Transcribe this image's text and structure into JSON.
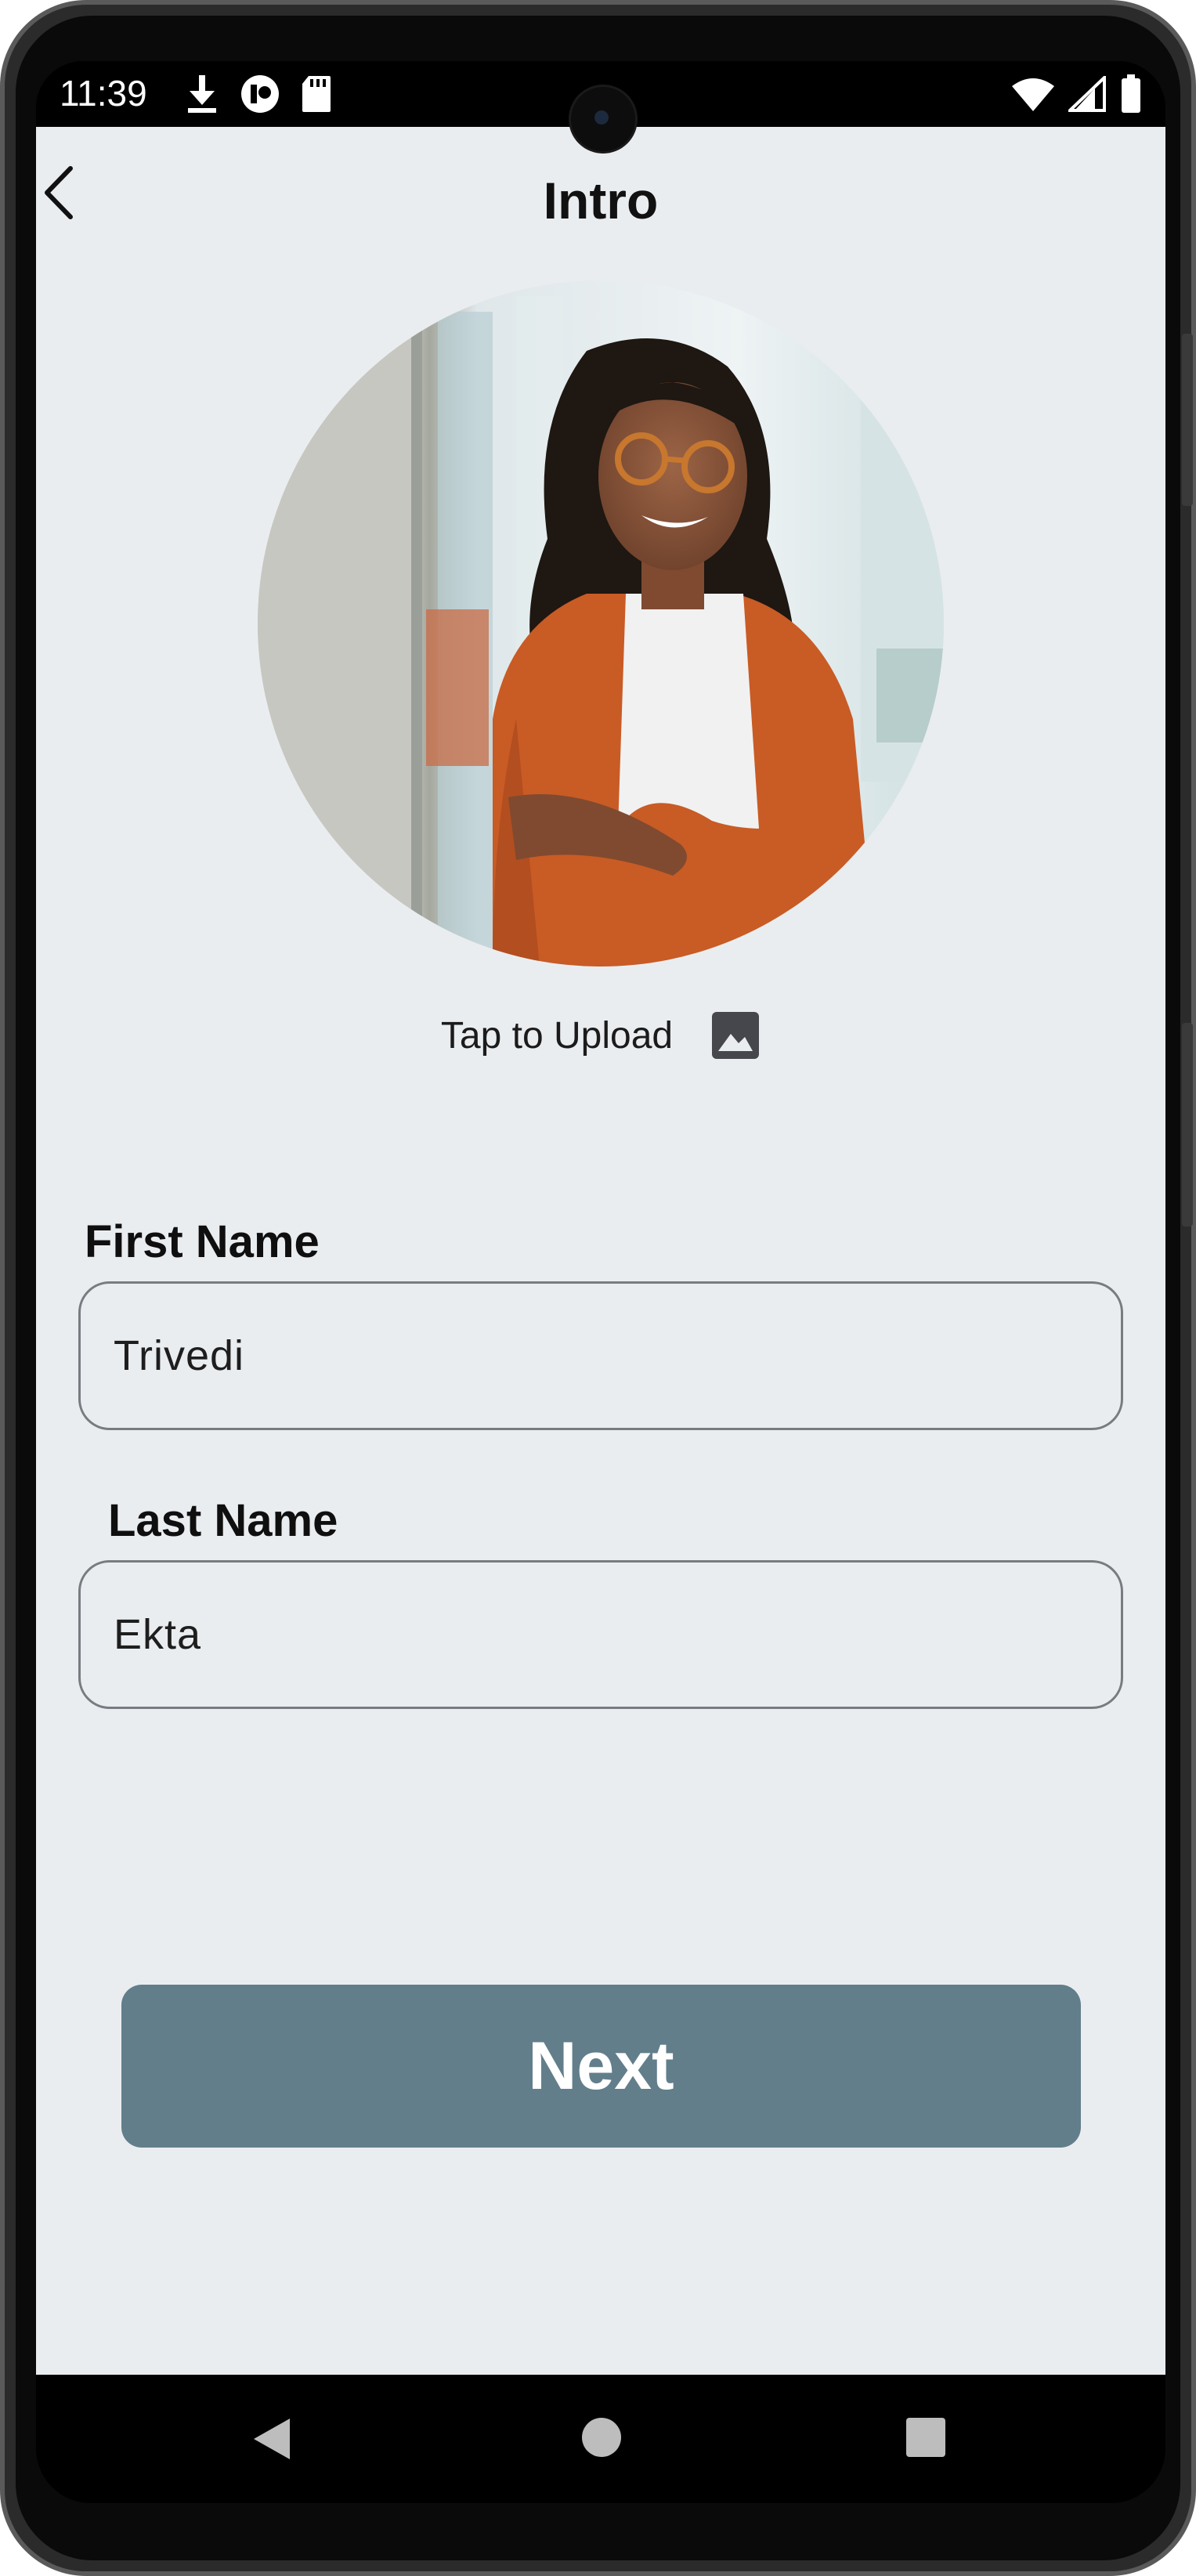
{
  "status_bar": {
    "time": "11:39",
    "left_icons": [
      "download-icon",
      "vpn-icon",
      "sd-card-icon"
    ],
    "right_icons": [
      "wifi-icon",
      "signal-icon",
      "battery-icon"
    ]
  },
  "header": {
    "title": "Intro"
  },
  "profile": {
    "upload_label": "Tap to Upload"
  },
  "form": {
    "first_name_label": "First Name",
    "first_name_value": "Trivedi",
    "last_name_label": "Last Name",
    "last_name_value": "Ekta"
  },
  "actions": {
    "next_label": "Next"
  },
  "colors": {
    "background": "#eaedf0",
    "button": "#627e8b",
    "field_border": "#777c80"
  }
}
